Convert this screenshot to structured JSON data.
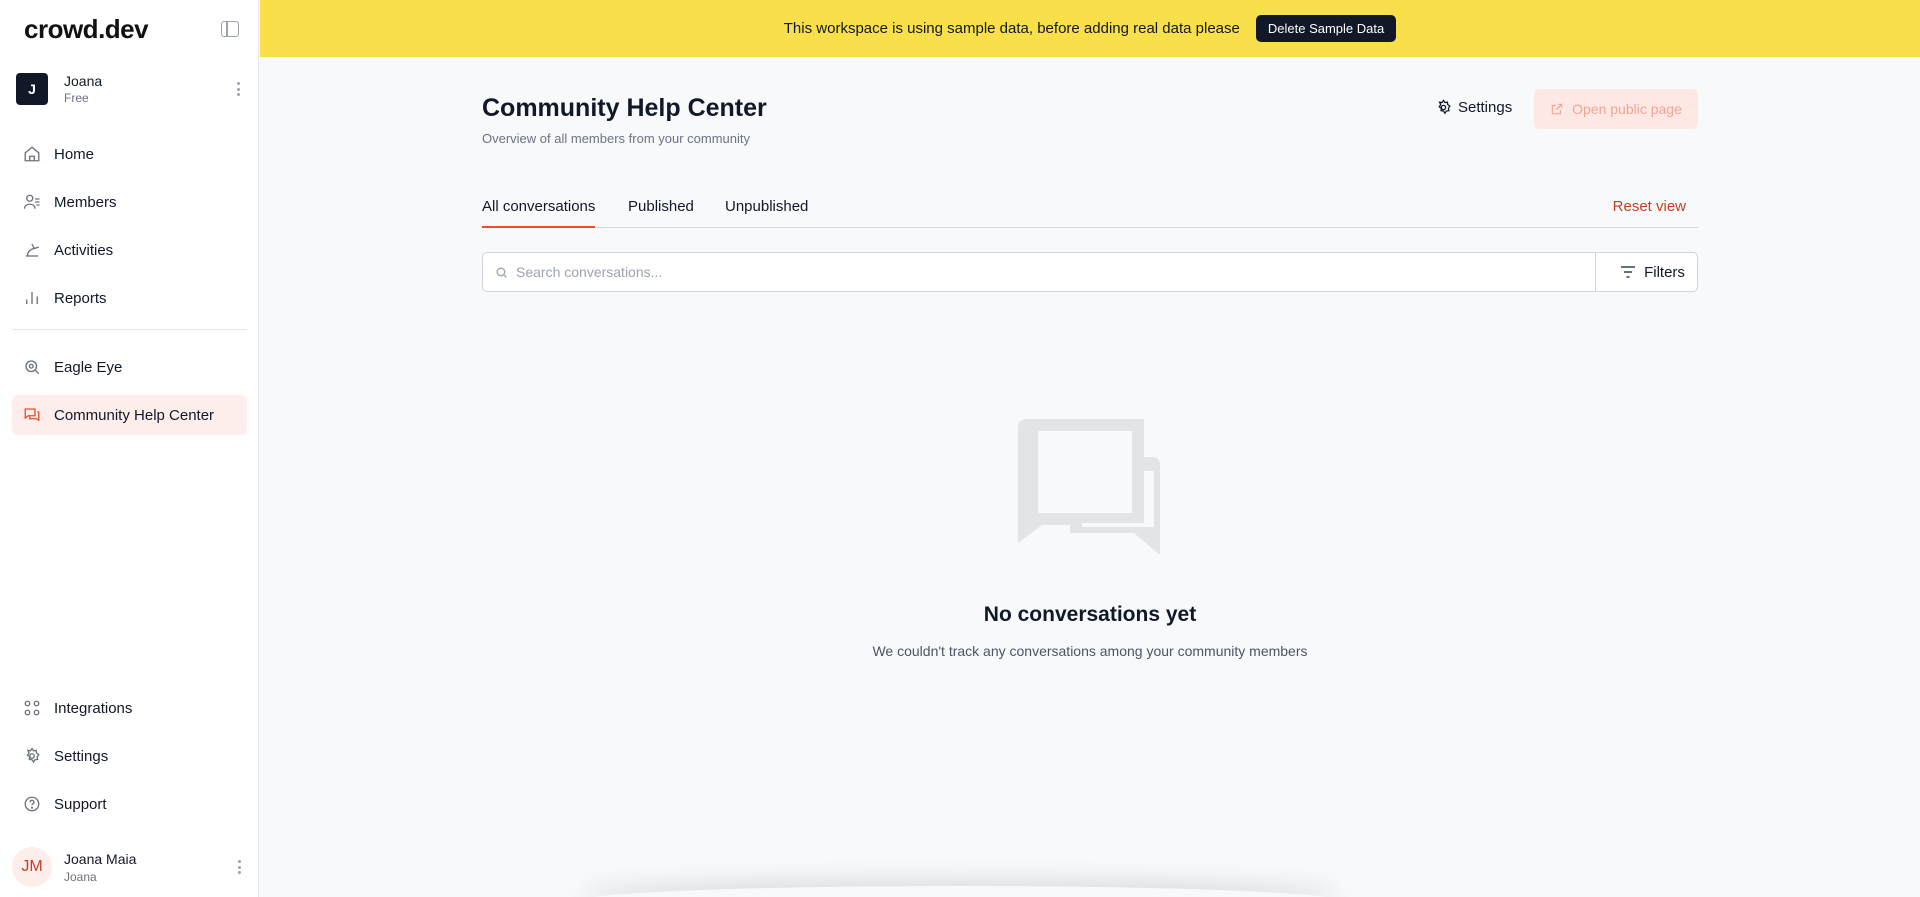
{
  "app": {
    "logo": "crowd.dev"
  },
  "workspace": {
    "initial": "J",
    "name": "Joana",
    "plan": "Free"
  },
  "sidebar": {
    "items": [
      {
        "label": "Home",
        "icon": "home-icon"
      },
      {
        "label": "Members",
        "icon": "members-icon"
      },
      {
        "label": "Activities",
        "icon": "activities-icon"
      },
      {
        "label": "Reports",
        "icon": "reports-icon"
      },
      {
        "label": "Eagle Eye",
        "icon": "eagle-eye-icon"
      },
      {
        "label": "Community Help Center",
        "icon": "chat-icon",
        "active": true
      }
    ],
    "bottom_items": [
      {
        "label": "Integrations",
        "icon": "integrations-icon"
      },
      {
        "label": "Settings",
        "icon": "gear-icon"
      },
      {
        "label": "Support",
        "icon": "help-icon"
      }
    ]
  },
  "user": {
    "initials": "JM",
    "name": "Joana Maia",
    "sub": "Joana"
  },
  "banner": {
    "text": "This workspace is using sample data, before adding real data please",
    "button": "Delete Sample Data"
  },
  "page": {
    "title": "Community Help Center",
    "subtitle": "Overview of all members from your community",
    "settings_label": "Settings",
    "open_public_label": "Open public page"
  },
  "tabs": [
    {
      "label": "All conversations",
      "active": true
    },
    {
      "label": "Published"
    },
    {
      "label": "Unpublished"
    }
  ],
  "reset_view": "Reset view",
  "search": {
    "placeholder": "Search conversations...",
    "value": ""
  },
  "filters_label": "Filters",
  "empty": {
    "title": "No conversations yet",
    "text": "We couldn't track any conversations among your community members"
  },
  "colors": {
    "accent": "#e94f2e",
    "banner": "#f9e04b",
    "active_bg": "#fdeeeb"
  }
}
